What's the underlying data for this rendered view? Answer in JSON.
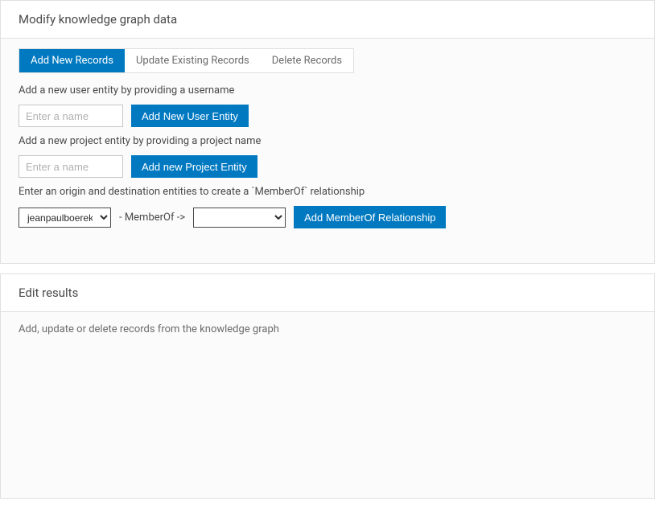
{
  "topPanel": {
    "title": "Modify knowledge graph data",
    "tabs": [
      {
        "label": "Add New Records",
        "active": true
      },
      {
        "label": "Update Existing Records",
        "active": false
      },
      {
        "label": "Delete Records",
        "active": false
      }
    ],
    "userSection": {
      "label": "Add a new user entity by providing a username",
      "placeholder": "Enter a name",
      "buttonLabel": "Add New User Entity"
    },
    "projectSection": {
      "label": "Add a new project entity by providing a project name",
      "placeholder": "Enter a name",
      "buttonLabel": "Add new Project Entity"
    },
    "relationshipSection": {
      "label": "Enter an origin and destination entities to create a `MemberOf` relationship",
      "originValue": "jeanpaulboerekamps",
      "relationText": "- MemberOf ->",
      "destValue": "",
      "buttonLabel": "Add MemberOf Relationship"
    }
  },
  "bottomPanel": {
    "title": "Edit results",
    "message": "Add, update or delete records from the knowledge graph"
  }
}
